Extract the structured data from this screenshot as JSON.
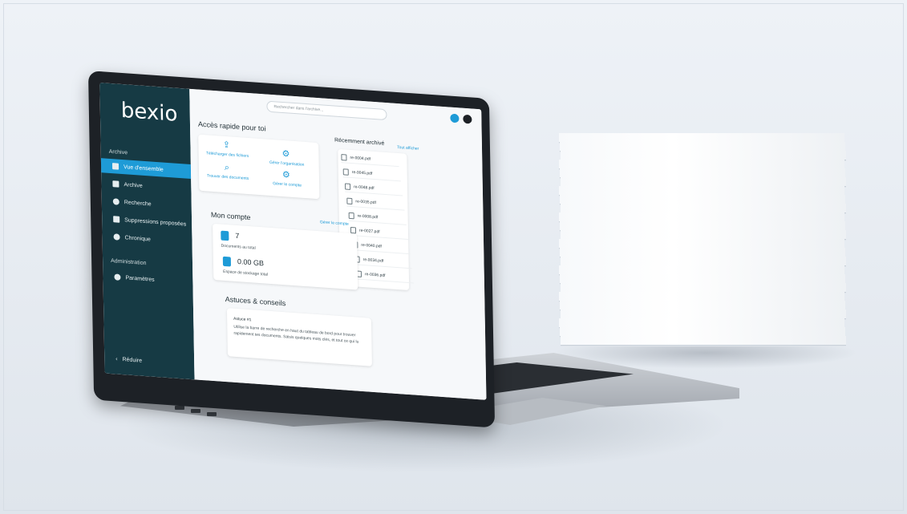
{
  "sidebar": {
    "logo": "bexio",
    "section_archive": "Archive",
    "items": [
      {
        "label": "Vue d'ensemble"
      },
      {
        "label": "Archive"
      },
      {
        "label": "Recherche"
      },
      {
        "label": "Suppressions proposées"
      },
      {
        "label": "Chronique"
      }
    ],
    "section_admin": "Administration",
    "admin_items": [
      {
        "label": "Paramètres"
      }
    ],
    "collapse_label": "Réduire"
  },
  "header": {
    "search_placeholder": "Rechercher dans l'archive..."
  },
  "quick_access": {
    "title": "Accès rapide pour toi",
    "actions": [
      {
        "label": "Télécharger des fichiers"
      },
      {
        "label": "Gérer l'organisation"
      },
      {
        "label": "Trouver des documents"
      },
      {
        "label": "Gérer le compte"
      }
    ]
  },
  "recent": {
    "title": "Récemment archivé",
    "link": "Tout afficher",
    "files": [
      "re-0004.pdf",
      "re-0045.pdf",
      "re-0048.pdf",
      "re-0035.pdf",
      "re-0008.pdf",
      "re-0027.pdf",
      "re-0040.pdf",
      "re-0034.pdf",
      "re-0036.pdf"
    ]
  },
  "account": {
    "title": "Mon compte",
    "link": "Gérer le compte",
    "documents_value": "7",
    "documents_label": "Documents au total",
    "storage_value": "0.00 GB",
    "storage_label": "Espace de stockage total"
  },
  "tips": {
    "title": "Astuces & conseils",
    "heading": "Astuce #1",
    "line1": "Utilise la barre de recherche en haut du tableau de bord pour trouver",
    "line2": "rapidement tes documents. Saisis quelques mots clés, et tout ce qui lu"
  }
}
